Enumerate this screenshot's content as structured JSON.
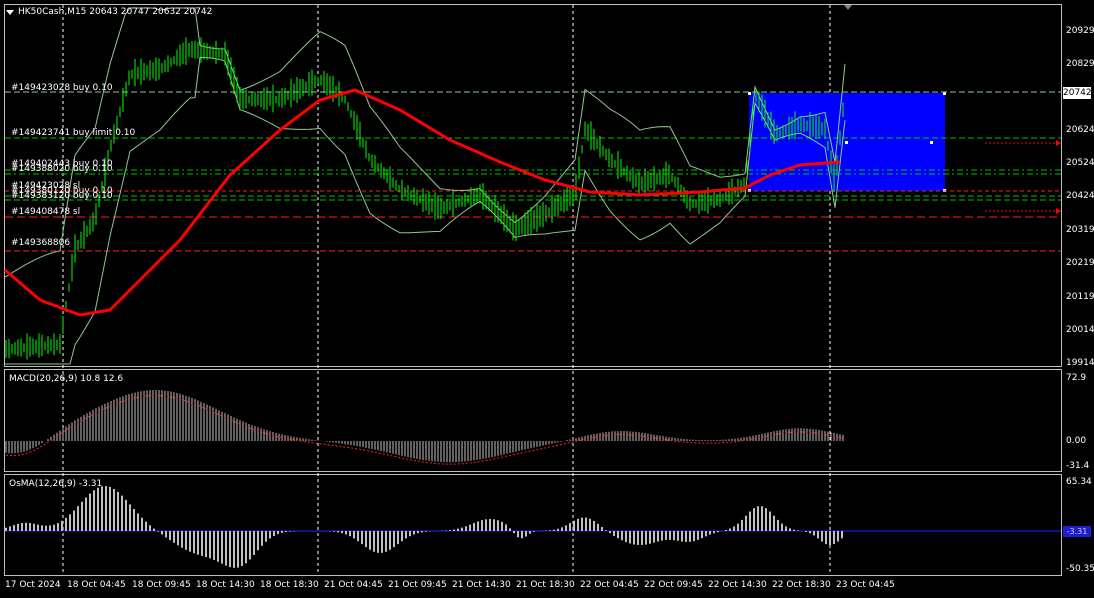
{
  "header": {
    "title": "HK50Cash,M15",
    "ohlc": "20643 20747 20632 20742"
  },
  "price_axis": {
    "labels": [
      "20929",
      "20829",
      "20624",
      "20524",
      "20424",
      "20319",
      "20219",
      "20119",
      "20014",
      "19914"
    ],
    "current": "20742"
  },
  "orders": [
    {
      "text": "#149423028 buy 0.10"
    },
    {
      "text": "#149423741 buy limit 0.10"
    },
    {
      "text": "#149402443 buy 0.10"
    },
    {
      "text": "#149388020 buy 0.10"
    },
    {
      "text": "#149423028 sl"
    },
    {
      "text": "#149380120 buy 0.10"
    },
    {
      "text": "#149383120 buy 0.10"
    },
    {
      "text": "#149408478 sl"
    },
    {
      "text": "#149368806"
    }
  ],
  "macd": {
    "label": "MACD(20,26,9) 10.8 12.6",
    "axis": [
      "72.9",
      "0.00",
      "-31.4"
    ]
  },
  "osma": {
    "label": "OsMA(12,26,9) -3.31",
    "axis": [
      "65.34",
      "-50.35"
    ],
    "current": "-3.31"
  },
  "time_axis": [
    "17 Oct 2024",
    "18 Oct 04:45",
    "18 Oct 09:45",
    "18 Oct 14:30",
    "18 Oct 18:30",
    "21 Oct 04:45",
    "21 Oct 09:45",
    "21 Oct 14:30",
    "21 Oct 18:30",
    "22 Oct 04:45",
    "22 Oct 09:45",
    "22 Oct 14:30",
    "22 Oct 18:30",
    "23 Oct 04:45"
  ],
  "colors": {
    "candles": "#00ff00",
    "ma": "#ff0000",
    "bands": "#90c890",
    "rect": "#0000ff",
    "hist": "#c0c0c0",
    "signal": "#ff2020",
    "osma_zero": "#2020ff"
  }
}
